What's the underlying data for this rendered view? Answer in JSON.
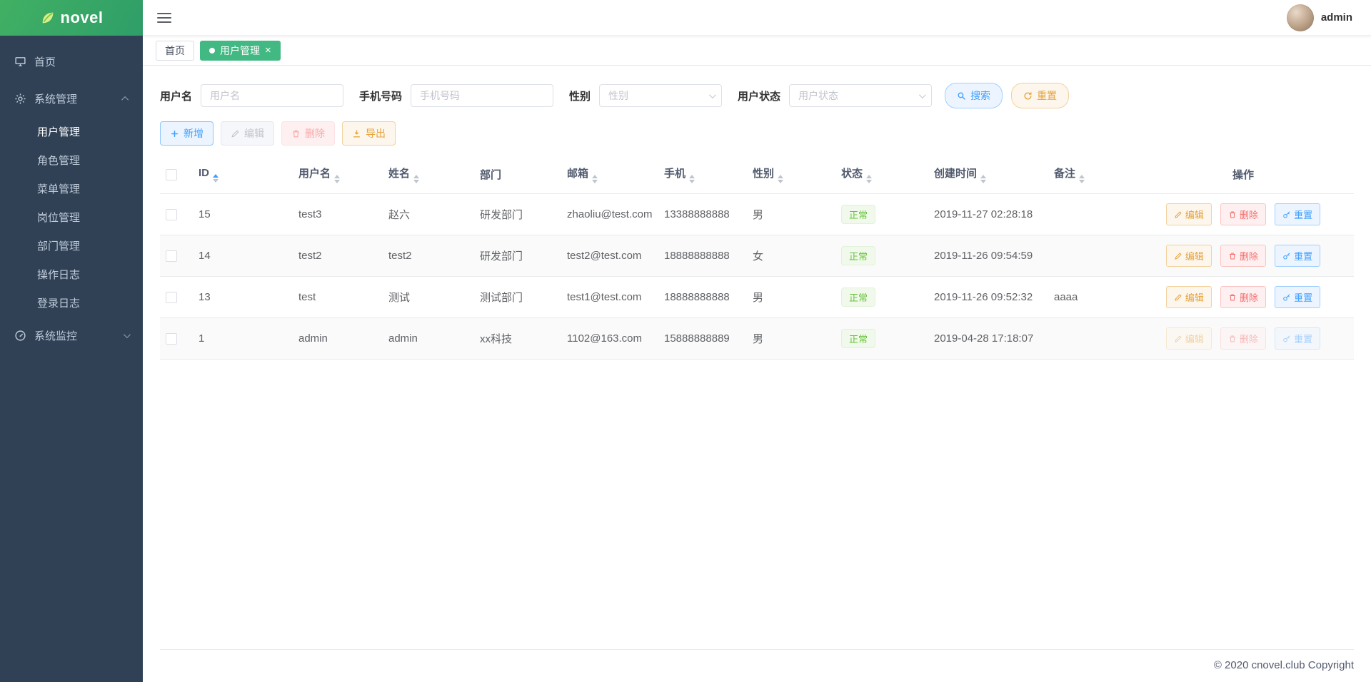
{
  "app": {
    "name": "novel",
    "user": "admin"
  },
  "sidebar": {
    "home": "首页",
    "system_management": "系统管理",
    "system_monitor": "系统监控",
    "system_children": [
      "用户管理",
      "角色管理",
      "菜单管理",
      "岗位管理",
      "部门管理",
      "操作日志",
      "登录日志"
    ]
  },
  "tabs": {
    "home": "首页",
    "user_mgmt": "用户管理"
  },
  "filters": {
    "username_label": "用户名",
    "username_placeholder": "用户名",
    "phone_label": "手机号码",
    "phone_placeholder": "手机号码",
    "gender_label": "性别",
    "gender_placeholder": "性别",
    "status_label": "用户状态",
    "status_placeholder": "用户状态",
    "search_label": "搜索",
    "reset_label": "重置"
  },
  "toolbar": {
    "add": "新增",
    "edit": "编辑",
    "delete": "删除",
    "export": "导出"
  },
  "table": {
    "headers": {
      "id": "ID",
      "username": "用户名",
      "name": "姓名",
      "dept": "部门",
      "email": "邮箱",
      "phone": "手机",
      "gender": "性别",
      "status": "状态",
      "created": "创建时间",
      "remark": "备注",
      "actions": "操作"
    },
    "row_actions": {
      "edit": "编辑",
      "delete": "删除",
      "reset": "重置"
    },
    "rows": [
      {
        "id": "15",
        "username": "test3",
        "name": "赵六",
        "dept": "研发部门",
        "email": "zhaoliu@test.com",
        "phone": "13388888888",
        "gender": "男",
        "status": "正常",
        "created": "2019-11-27 02:28:18",
        "remark": ""
      },
      {
        "id": "14",
        "username": "test2",
        "name": "test2",
        "dept": "研发部门",
        "email": "test2@test.com",
        "phone": "18888888888",
        "gender": "女",
        "status": "正常",
        "created": "2019-11-26 09:54:59",
        "remark": ""
      },
      {
        "id": "13",
        "username": "test",
        "name": "测试",
        "dept": "测试部门",
        "email": "test1@test.com",
        "phone": "18888888888",
        "gender": "男",
        "status": "正常",
        "created": "2019-11-26 09:52:32",
        "remark": "aaaa"
      },
      {
        "id": "1",
        "username": "admin",
        "name": "admin",
        "dept": "xx科技",
        "email": "1102@163.com",
        "phone": "15888888889",
        "gender": "男",
        "status": "正常",
        "created": "2019-04-28 17:18:07",
        "remark": ""
      }
    ]
  },
  "footer": {
    "copyright": "© 2020 cnovel.club Copyright"
  },
  "colors": {
    "primary": "#409eff",
    "success_tab": "#42b983",
    "warning": "#e6a23c",
    "danger": "#f56c6c",
    "sidebar_bg": "#304156",
    "logo_green": "#3aa765",
    "status_ok_text": "#67c23a"
  }
}
